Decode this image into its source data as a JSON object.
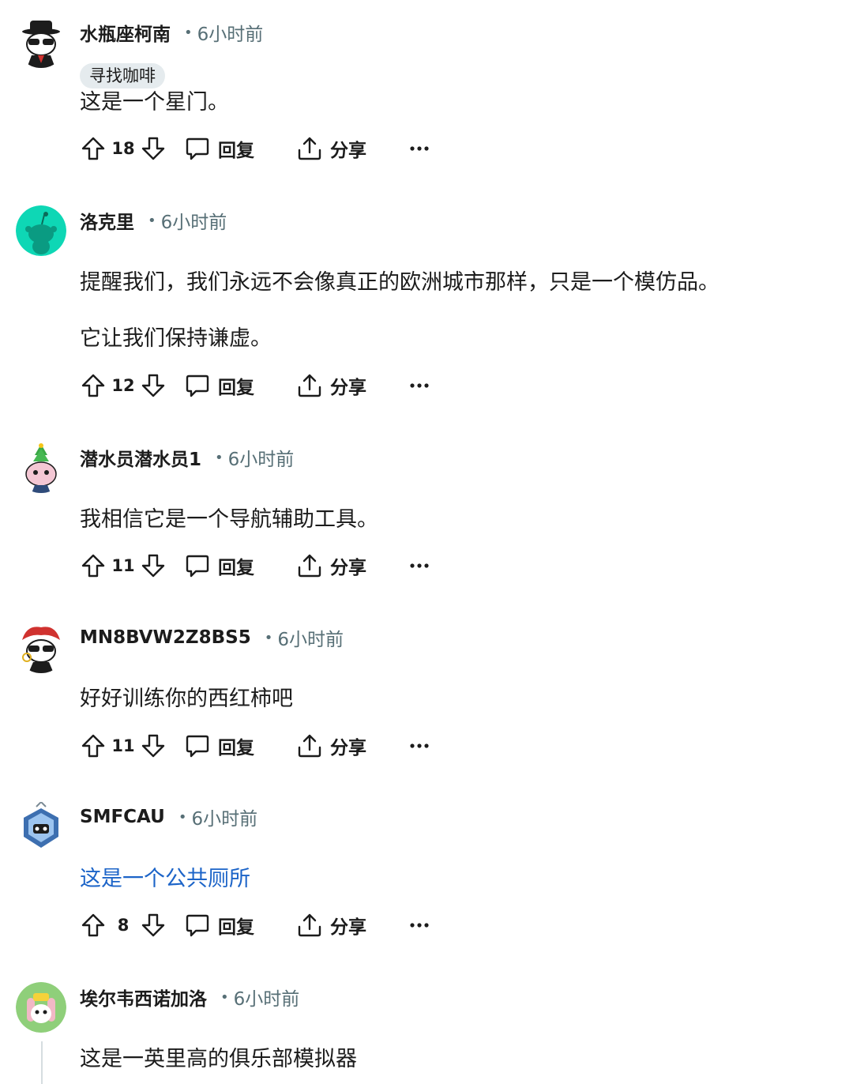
{
  "comments": [
    {
      "username": "水瓶座柯南",
      "time": "6小时前",
      "flair": "寻找咖啡",
      "body": [
        "这是一个星门。"
      ],
      "score": "18",
      "reply_label": "回复",
      "share_label": "分享",
      "avatar_color": "#ffffff"
    },
    {
      "username": "洛克里",
      "time": "6小时前",
      "body": [
        "提醒我们，我们永远不会像真正的欧洲城市那样，只是一个模仿品。",
        "它让我们保持谦虚。"
      ],
      "score": "12",
      "reply_label": "回复",
      "share_label": "分享",
      "avatar_color": "#0ed7b5"
    },
    {
      "username": "潜水员潜水员1",
      "time": "6小时前",
      "body": [
        "我相信它是一个导航辅助工具。"
      ],
      "score": "11",
      "reply_label": "回复",
      "share_label": "分享",
      "avatar_color": "#ffffff"
    },
    {
      "username": "MN8BVW2Z8BS5",
      "time": "6小时前",
      "body": [
        "好好训练你的西红柿吧"
      ],
      "score": "11",
      "reply_label": "回复",
      "share_label": "分享",
      "avatar_color": "#ffffff"
    },
    {
      "username": "SMFCAU",
      "time": "6小时前",
      "body": [
        "这是一个公共厕所"
      ],
      "score": "8",
      "reply_label": "回复",
      "share_label": "分享",
      "avatar_color": "#ffffff"
    },
    {
      "username": "埃尔韦西诺加洛",
      "time": "6小时前",
      "body": [
        "这是一英里高的俱乐部模拟器"
      ],
      "avatar_color": "#8fcf7a"
    }
  ],
  "colors": {
    "text": "#1c1c1c",
    "meta": "#576f76",
    "link": "#1c64c8",
    "flair_bg": "#e5ebee",
    "thread_line": "#d6dde0"
  },
  "icons": {
    "upvote": "arrow-up-outline-icon",
    "downvote": "arrow-down-outline-icon",
    "reply": "speech-bubble-icon",
    "share": "share-upload-icon",
    "more": "ellipsis-icon"
  }
}
